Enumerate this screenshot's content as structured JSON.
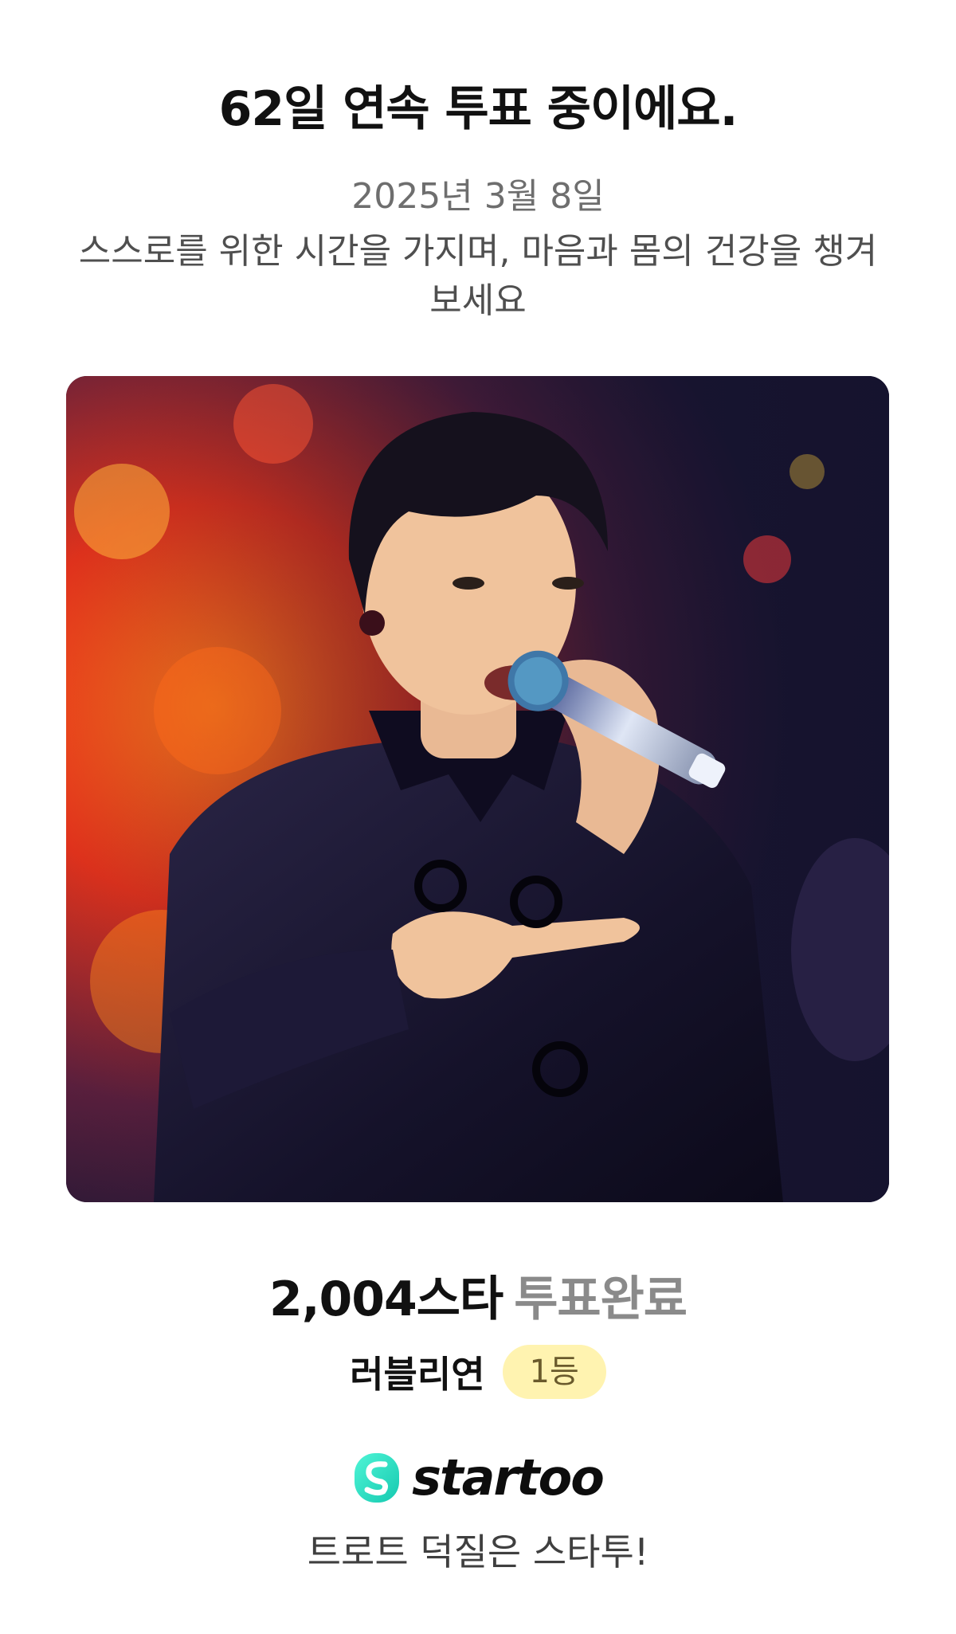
{
  "header": {
    "title": "62일 연속 투표 중이에요.",
    "date": "2025년 3월 8일",
    "message": "스스로를 위한 시간을 가지며, 마음과 몸의 건강을 챙겨보세요"
  },
  "photo": {
    "subject": "singer-performing-photo"
  },
  "votes": {
    "count": "2,004스타",
    "status": "투표완료"
  },
  "fan": {
    "name": "러블리연",
    "rank": "1등"
  },
  "brand": {
    "logo_text": "startoo",
    "tagline": "트로트 덕질은 스타투!",
    "accent_color": "#2ee6c5"
  }
}
